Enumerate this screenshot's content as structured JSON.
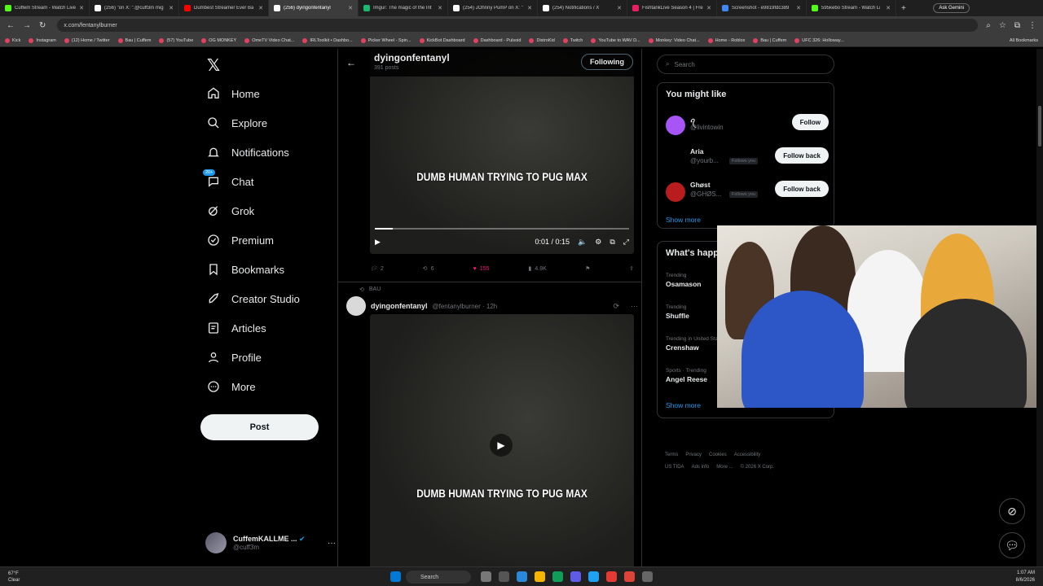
{
  "browser": {
    "tabs": [
      {
        "title": "Cuffem Stream - Watch Live",
        "color": "#53fc18"
      },
      {
        "title": "(256) \"on X: \".@cuff3m mig",
        "color": "#ffffff"
      },
      {
        "title": "Dumbest Streamer Ever Ba",
        "color": "#ff0000"
      },
      {
        "title": "(256) dyingonfentanyl",
        "color": "#ffffff",
        "active": true
      },
      {
        "title": "Imgur: The magic of the Int",
        "color": "#1bb76e"
      },
      {
        "title": "(254) JOhnny PumP on X: \"",
        "color": "#ffffff"
      },
      {
        "title": "(254) Notifications / X",
        "color": "#ffffff"
      },
      {
        "title": "FishtankLive Season 4 | Fre",
        "color": "#e91e63"
      },
      {
        "title": "Screenshot - e9819fdc389",
        "color": "#4285f4"
      },
      {
        "title": "595kebo Stream - Watch Li",
        "color": "#53fc18"
      }
    ],
    "new_tab": "+",
    "ask_gemini": "Ask Gemini",
    "url": "x.com/fentanylburner",
    "bookmarks": [
      "Kick",
      "Instagram",
      "(12) Home / Twitter",
      "Bau | Cuffem",
      "(57) YouTube",
      "OG MONKEY",
      "OmeTV Video Chat...",
      "IRLToolkit • Dashbo...",
      "Picker Wheel - Spin...",
      "KickBot Dashboard",
      "Dashboard - Pulsoid",
      "DistroKid",
      "Twitch",
      "YouTube to WAV D...",
      "Monkey: Video Chat...",
      "Home - Roblox",
      "Bau | Cuffem",
      "UFC 326: Holloway..."
    ],
    "all_bookmarks": "All Bookmarks"
  },
  "nav": {
    "items": [
      {
        "label": "Home",
        "icon": "home-icon"
      },
      {
        "label": "Explore",
        "icon": "search-icon"
      },
      {
        "label": "Notifications",
        "icon": "bell-icon"
      },
      {
        "label": "Chat",
        "icon": "chat-icon",
        "badge": "20+"
      },
      {
        "label": "Grok",
        "icon": "grok-icon"
      },
      {
        "label": "Premium",
        "icon": "premium-icon"
      },
      {
        "label": "Bookmarks",
        "icon": "bookmark-icon"
      },
      {
        "label": "Creator Studio",
        "icon": "rocket-icon"
      },
      {
        "label": "Articles",
        "icon": "article-icon"
      },
      {
        "label": "Profile",
        "icon": "person-icon"
      },
      {
        "label": "More",
        "icon": "more-icon"
      }
    ],
    "post_label": "Post",
    "account": {
      "name": "CuffemKALLME ...",
      "handle": "@cuff3m"
    }
  },
  "profile_header": {
    "title": "dyingonfentanyl",
    "subtitle": "391 posts",
    "following_label": "Following"
  },
  "tweet1": {
    "caption": "DUMB HUMAN TRYING TO PUG MAX",
    "time": "0:01 / 0:15",
    "progress": 0.07,
    "replies": "2",
    "reposts": "6",
    "likes": "155",
    "views": "4.9K"
  },
  "tweet2": {
    "repost_label": "BAU",
    "name": "dyingonfentanyl",
    "handle": "@fentanylburner",
    "time": "12h",
    "caption": "DUMB HUMAN TRYING TO PUG MAX"
  },
  "sidebar": {
    "search_placeholder": "Search",
    "wtf_title": "You might like",
    "suggestions": [
      {
        "name": "ꪖ",
        "handle": "@livintowin",
        "button": "Follow",
        "follows_you": "",
        "avatar_color": "#a855f7"
      },
      {
        "name": "Aria",
        "handle": "@yourb...",
        "button": "Follow back",
        "follows_you": "Follows you",
        "avatar_color": "#000000"
      },
      {
        "name": "Ghøst",
        "handle": "@GHØS...",
        "button": "Follow back",
        "follows_you": "Follows you",
        "avatar_color": "#b91c1c"
      }
    ],
    "show_more": "Show more",
    "happening_title": "What's happening",
    "trends": [
      {
        "context": "Trending",
        "topic": "Osamason"
      },
      {
        "context": "Trending",
        "topic": "Shuffle"
      },
      {
        "context": "Trending in United States",
        "topic": "Crenshaw"
      },
      {
        "context": "Sports · Trending",
        "topic": "Angel Reese"
      }
    ],
    "show_more_2": "Show more"
  },
  "footer": {
    "links": [
      "Terms",
      "Privacy",
      "Cookies",
      "Accessibility",
      "US TIDA",
      "Ads info",
      "More ...",
      "© 2026 X Corp."
    ]
  },
  "taskbar": {
    "weather_temp": "67°F",
    "weather_cond": "Clear",
    "search": "Search",
    "time": "1:07 AM",
    "date": "8/6/2026"
  }
}
